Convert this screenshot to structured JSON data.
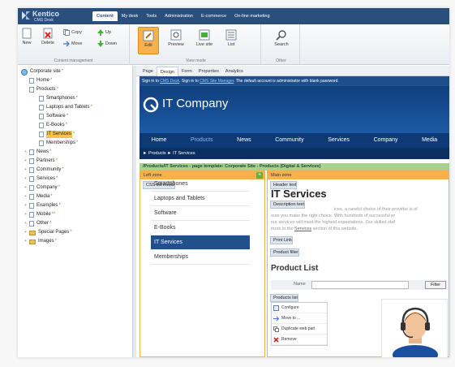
{
  "app": {
    "logo_title": "Kentico",
    "logo_subtitle": "CMS Desk"
  },
  "topnav": [
    "Content",
    "My desk",
    "Tools",
    "Administration",
    "E-commerce",
    "On-line marketing"
  ],
  "ribbon": {
    "new": "New",
    "delete": "Delete",
    "copy": "Copy",
    "move": "Move",
    "up": "Up",
    "down": "Down",
    "group_content": "Content management",
    "edit": "Edit",
    "preview": "Preview",
    "live_site": "Live site",
    "list": "List",
    "group_view": "View mode",
    "search": "Search",
    "group_other": "Other"
  },
  "tree": [
    {
      "label": "Corporate site",
      "dot": "*"
    },
    {
      "label": "Home",
      "dot": "*"
    },
    {
      "label": "Products",
      "dot": "*"
    },
    {
      "label": "Smartphones",
      "dot": "*"
    },
    {
      "label": "Laptops and Tablets",
      "dot": "*"
    },
    {
      "label": "Software",
      "dot": "*"
    },
    {
      "label": "E-Books",
      "dot": "*"
    },
    {
      "label": "IT Services",
      "dot": "*"
    },
    {
      "label": "Memberships",
      "dot": "*"
    },
    {
      "label": "News",
      "dot": "*"
    },
    {
      "label": "Partners",
      "dot": "*"
    },
    {
      "label": "Community",
      "dot": "*"
    },
    {
      "label": "Services",
      "dot": "*"
    },
    {
      "label": "Company",
      "dot": "*"
    },
    {
      "label": "Media",
      "dot": "*"
    },
    {
      "label": "Examples",
      "dot": "*"
    },
    {
      "label": "Mobile",
      "dot": "**"
    },
    {
      "label": "Other",
      "dot": "*"
    },
    {
      "label": "Special Pages",
      "dot": "*"
    },
    {
      "label": "Images",
      "dot": "*"
    }
  ],
  "subtabs": [
    "Page",
    "Design",
    "Form",
    "Properties",
    "Analytics"
  ],
  "site": {
    "signin_prefix": "Sign in to",
    "signin_link1": "CMS Desk",
    "signin_mid": ". Sign in to",
    "signin_link2": "CMS Site Manager",
    "signin_suffix": ". The default account is administrator with blank password.",
    "brand": "IT Company",
    "nav": [
      "Home",
      "Products",
      "News",
      "Community",
      "Services",
      "Company",
      "Media"
    ],
    "breadcrumb": "► Products ► IT Services"
  },
  "template_bar": "/Products/IT Services - page template: Corporate Site - Products (Digital & Services)",
  "left_zone": {
    "label": "Left zone",
    "webpart": "CSS list menu",
    "menu": [
      "Smartphones",
      "Laptops and Tablets",
      "Software",
      "E-Books",
      "IT Services",
      "Memberships"
    ]
  },
  "main_zone": {
    "label": "Main zone",
    "header_wp": "Header text",
    "title": "IT Services",
    "desc_wp": "Description text",
    "para_a": "ices, a careful choice of their provider is of",
    "para_b": "sure you make the right choice. With hundreds of successful pr",
    "para_c": "our services will meet the highest expectations. Our skilled staf",
    "para_d1": "more in the",
    "para_link": "Services",
    "para_d2": "section of this website.",
    "printlink_wp": "Print Link",
    "filter_wp": "Product filter",
    "list_title": "Product List",
    "filter_name": "Name",
    "filter_button": "Filter",
    "products_wp": "Products list",
    "context_menu": [
      "Configure",
      "Move to ...",
      "Duplicate web part",
      "Remove"
    ]
  },
  "colors": {
    "topbar": "#2b4f7d",
    "selected": "#f6b24a",
    "site_nav": "#0d3a75",
    "template_bar": "#a9d18e",
    "menu_active": "#1f4f8c"
  }
}
